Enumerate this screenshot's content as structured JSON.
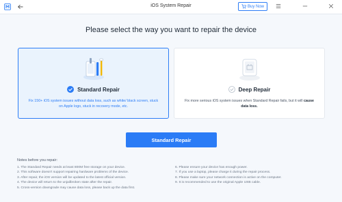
{
  "window": {
    "title": "iOS System Repair",
    "buy_now": "Buy Now"
  },
  "main": {
    "heading": "Please select the way you want to repair the device",
    "modes": [
      {
        "name": "Standard Repair",
        "description": "Fix 150+ iOS system issues without data loss, such as white/ black screen, stuck on Apple logo, stuck in recovery mode, etc.",
        "selected": true
      },
      {
        "name": "Deep Repair",
        "description_prefix": "Fix more serious iOS system issues when Standard Repair fails, but it will ",
        "description_bold": "cause data loss.",
        "selected": false
      }
    ],
    "action_button": "Standard Repair"
  },
  "notes": {
    "title": "Notes before you repair:",
    "left": [
      "1. The Standard Repair needs at least 800M free storage on your device.",
      "2. This software doesn't support repairing hardware problems of the device.",
      "3. After repair, the iOS version will be updated to the latest official version.",
      "4. The device will return to the unjailbroken state after the repair.",
      "5. Cross-version downgrade may cause data loss, please back up the data first."
    ],
    "right": [
      "6. Please ensure your device has enough power.",
      "7. If you use a laptop, please charge it during the repair process.",
      "8. Please make sure your network connection is active on the computer.",
      "9. It is recommended to use the original Apple USB cable."
    ]
  },
  "colors": {
    "accent": "#2b7cf6",
    "selected_card_bg": "#eaf3fd"
  }
}
